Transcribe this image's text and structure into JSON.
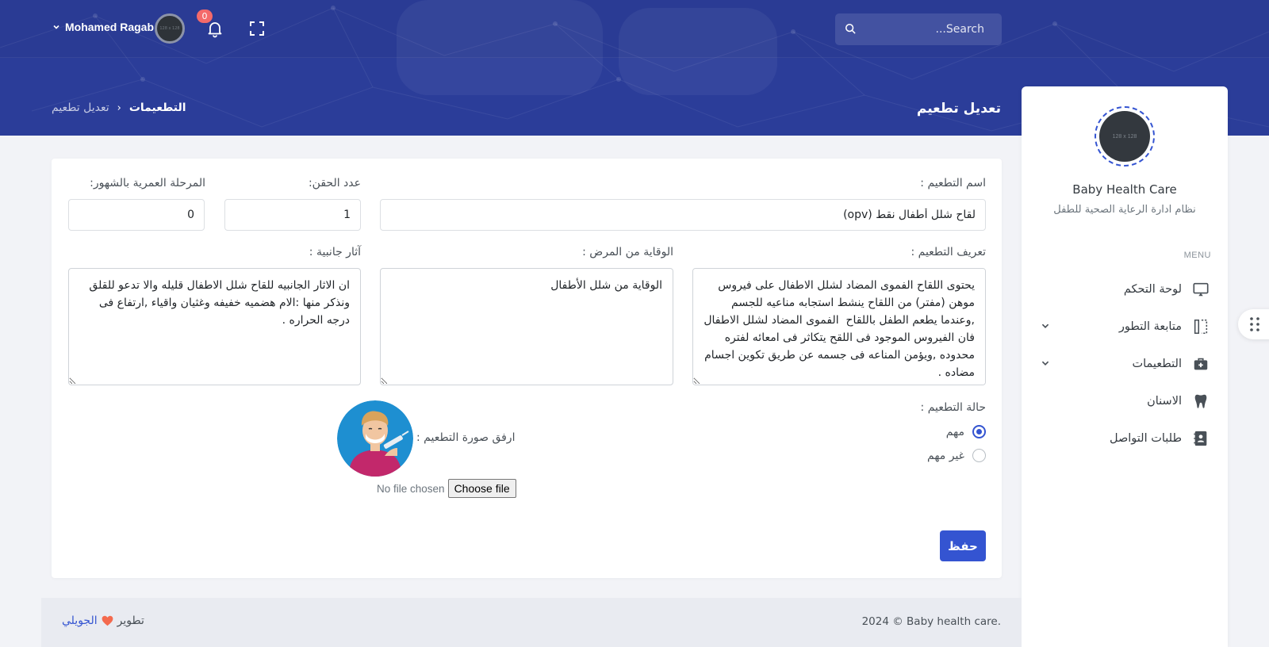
{
  "topbar": {
    "search_placeholder": "Search...",
    "notification_count": "0",
    "user_name": "Mohamed Ragab",
    "avatar_text": "128 x 128"
  },
  "page": {
    "title": "تعديل تطعيم",
    "breadcrumb": [
      {
        "label": "التطعيمات"
      },
      {
        "label": "تعديل تطعيم"
      }
    ]
  },
  "sidebar": {
    "logo_text": "128 x 128",
    "app_name": "Baby Health Care",
    "app_subtitle": "نظام ادارة الرعاية الصحية للطفل",
    "menu_title": "MENU",
    "items": [
      {
        "label": "لوحة التحكم",
        "icon": "monitor-icon"
      },
      {
        "label": "متابعة التطور",
        "icon": "columns-icon",
        "expandable": true
      },
      {
        "label": "التطعيمات",
        "icon": "medical-kit-icon",
        "expandable": true
      },
      {
        "label": "الاسنان",
        "icon": "tooth-icon"
      },
      {
        "label": "طلبات التواصل",
        "icon": "contact-book-icon"
      }
    ]
  },
  "form": {
    "name_label": "اسم التطعيم :",
    "name_value": "لقاح شلل أطفال نقط (opv)",
    "doses_label": "عدد الحقن:",
    "doses_value": "1",
    "age_label": "المرحلة العمرية بالشهور:",
    "age_value": "0",
    "definition_label": "تعريف التطعيم :",
    "definition_value": "يحتوى اللقاح الفموى المضاد لشلل الاطفال على فيروس موهن (مفتر) من اللقاح ينشط استجابه مناعيه للجسم ,وعندما يطعم الطفل باللقاح  الفموى المضاد لشلل الاطفال  فان الفيروس الموجود فى اللقح يتكاثر فى امعائه لفتره محدوده ,ويؤمن المناعه فى جسمه عن طريق تكوين اجسام مضاده .\nيعطى اللقاح عن طريق الفم على شكل نقاط.",
    "prevention_label": "الوقاية من المرض :",
    "prevention_value": "الوقاية من شلل الأطفال",
    "side_effects_label": "آثار جانبية :",
    "side_effects_value": "ان الاثار الجانبيه للقاح شلل الاطفال قليله والا تدعو للقلق ونذكر منها :الام هضميه خفيفه وغثيان واقياء ,ارتفاع فى درجه الحراره .",
    "status_label": "حالة التطعيم :",
    "status_options": [
      {
        "label": "مهم",
        "checked": true
      },
      {
        "label": "غير مهم",
        "checked": false
      }
    ],
    "image_label": "ارفق صورة التطعيم :",
    "file_status": "No file chosen",
    "choose_file": "Choose file",
    "save_label": "حفظ"
  },
  "footer": {
    "copyright": "2024 © Baby health care.",
    "dev_prefix": "تطوير",
    "dev_author": "الجويلي"
  },
  "colors": {
    "header": "#2b3d99",
    "primary": "#3454d1",
    "badge": "#f46a6a"
  }
}
